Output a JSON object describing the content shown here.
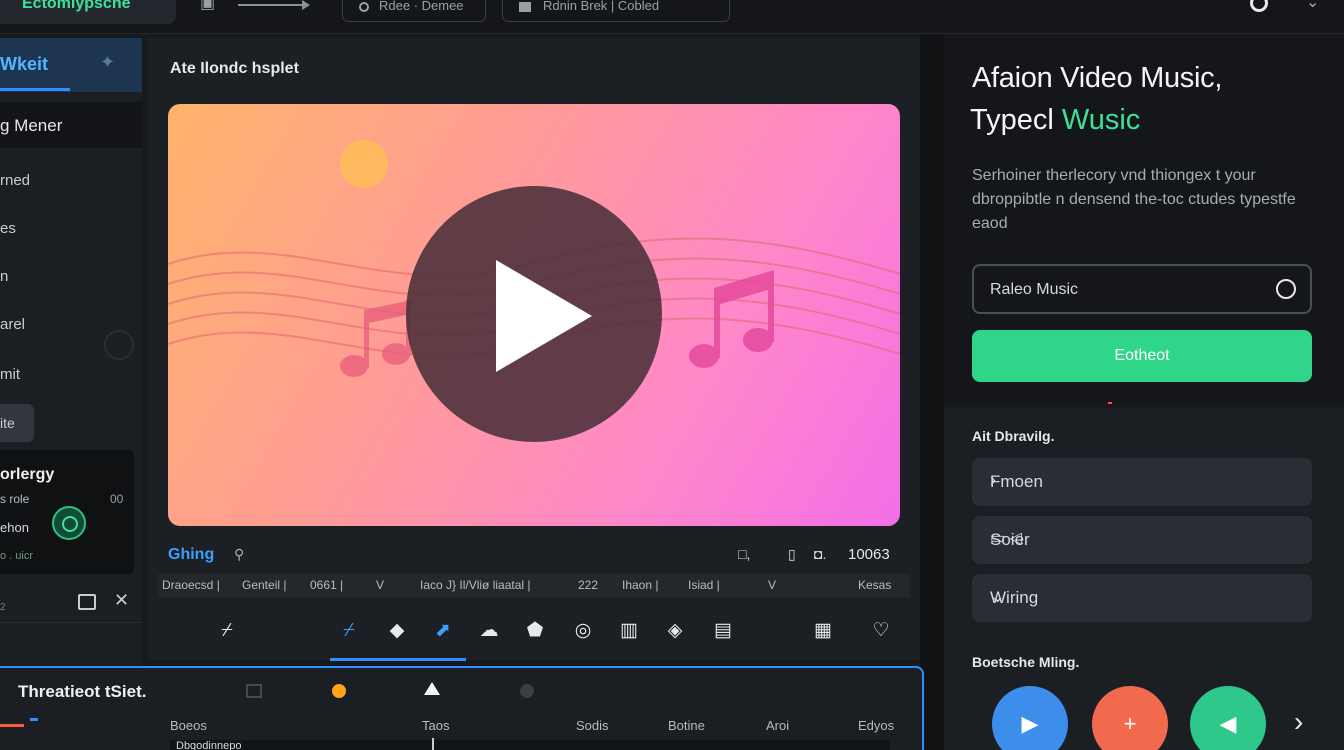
{
  "topbar": {
    "brand": "Ectomiypsche",
    "pill1": "Rdee · Demee",
    "pill2": "Rdnin Brek  |  Cobled"
  },
  "sidebar": {
    "header": "Wkeit",
    "selected": "g Mener",
    "items": [
      "rned",
      "es",
      "n",
      "arel",
      "mit"
    ],
    "chip": "ite",
    "card": {
      "title": "orlergy",
      "sub": "s role",
      "sub_right": "00",
      "row": "ehon",
      "foot": "o . uicr"
    },
    "foot_tiny": "2"
  },
  "center": {
    "title": "Ate Ilondc hsplet",
    "ctrl": {
      "left": "Ghing",
      "r1": "□,",
      "r2": "▯",
      "r3": "◘.",
      "r4": "10063"
    },
    "tabs": [
      "Draoecsd |",
      "Genteil |",
      "0661 |",
      "V",
      "Iaco J} Il/Vliø liaatal |",
      "222",
      "Ihaon |",
      "Isiad |",
      "V",
      "Kesas"
    ],
    "tools": [
      "⌿",
      "◆",
      "⬈",
      "☁",
      "⬟",
      "◎",
      "▥",
      "◈",
      "▤",
      "▦",
      "♡"
    ]
  },
  "timeline": {
    "title": "Threatieot tSiet.",
    "columns": [
      "Boeos",
      "Taos",
      "Sodis",
      "Botine",
      "Aroi",
      "Edyos"
    ],
    "cell": "Dbgodinnepo"
  },
  "right": {
    "heading_line1": "Afaion Video Music,",
    "heading_line2_prefix": "Typecl ",
    "heading_line2_accent": "Wusic",
    "paragraph": "Serhoiner therlecory vnd thiongex t your dbroppibtle n densend the-toc ctudes typestfe eaod",
    "input_value": "Raleo Music",
    "primary_button": "Eotheot",
    "section1": "Ait Dbravilg.",
    "rows": [
      {
        "label": "Fmoen"
      },
      {
        "label": "Soier"
      },
      {
        "label": "Wiring"
      }
    ],
    "section2": "Boetsche Mling."
  },
  "colors": {
    "accent_green": "#2fd589",
    "accent_blue": "#2f8fff",
    "bg": "#17191d"
  }
}
